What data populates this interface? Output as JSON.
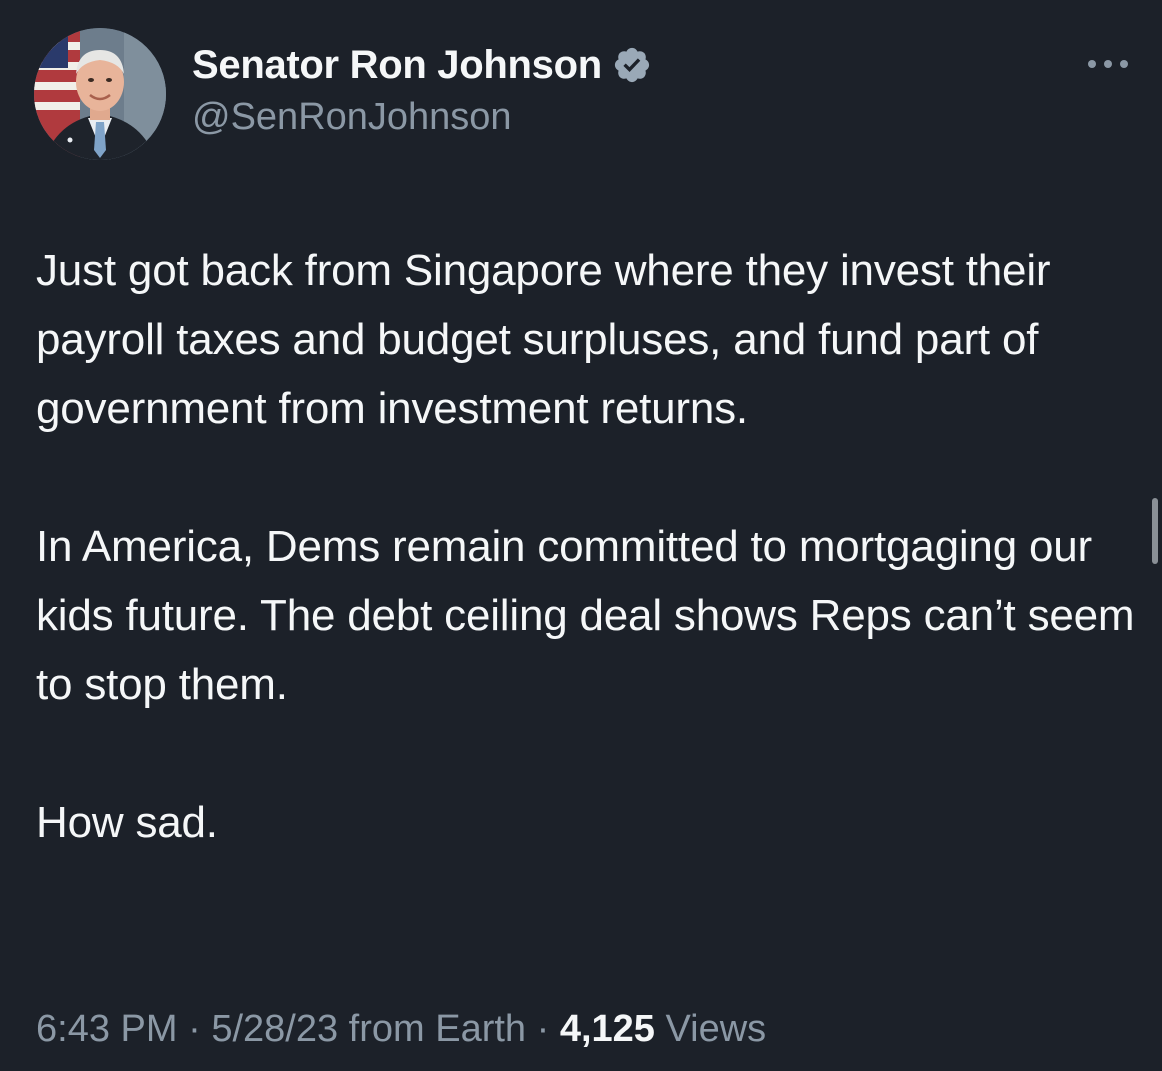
{
  "author": {
    "display_name": "Senator Ron Johnson",
    "handle": "@SenRonJohnson",
    "verified_icon": "verified-badge-icon",
    "badge_color": "#9aa9b7"
  },
  "menu": {
    "more_icon": "more-options-icon"
  },
  "tweet": {
    "paragraphs": [
      "Just got back from Singapore where they invest their payroll taxes and budget surpluses, and fund part of government from investment returns.",
      "In America, Dems remain committed to mortgaging our kids future. The debt ceiling deal shows Reps can’t seem to stop them.",
      "How sad."
    ]
  },
  "meta": {
    "time": "6:43 PM",
    "separator": " · ",
    "date": "5/28/23",
    "source": "from Earth",
    "views_count": "4,125",
    "views_label": "Views"
  },
  "colors": {
    "background": "#1c2129",
    "text_primary": "#f5f7f8",
    "text_secondary": "#8b98a5"
  }
}
